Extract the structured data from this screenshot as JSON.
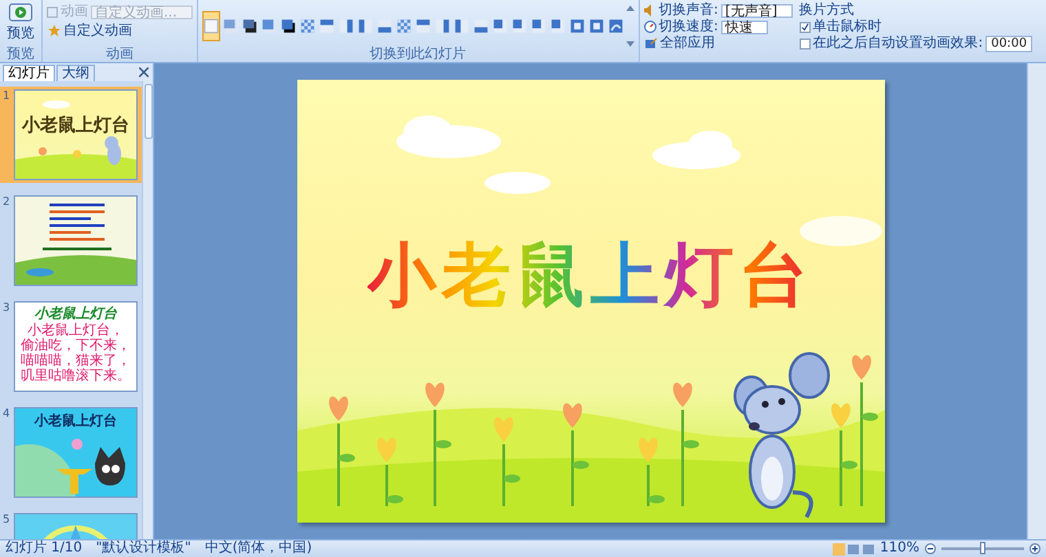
{
  "ribbon": {
    "preview": {
      "button": "预览",
      "group_label": "预览"
    },
    "animation": {
      "animate_label": "动画",
      "animate_select": "自定义动画...",
      "disabled": true,
      "custom_button": "自定义动画",
      "group_label": "动画"
    },
    "transitions": {
      "group_label": "切换到此幻灯片",
      "items": [
        {
          "kind": "plain",
          "selected": true
        },
        {
          "kind": "fade",
          "selected": false
        },
        {
          "kind": "fade-dark",
          "selected": false
        },
        {
          "kind": "cover",
          "selected": false
        },
        {
          "kind": "cover-dark",
          "selected": false
        },
        {
          "kind": "checker",
          "selected": false
        },
        {
          "kind": "bar-down",
          "selected": false
        },
        {
          "kind": "bar-left",
          "selected": false
        },
        {
          "kind": "bar-right",
          "selected": false
        },
        {
          "kind": "bar-up",
          "selected": false
        },
        {
          "kind": "checker",
          "selected": false
        },
        {
          "kind": "bar-down",
          "selected": false
        },
        {
          "kind": "bar-left",
          "selected": false
        },
        {
          "kind": "bar-right",
          "selected": false
        },
        {
          "kind": "bar-up",
          "selected": false
        },
        {
          "kind": "corner",
          "selected": false
        },
        {
          "kind": "corner",
          "selected": false
        },
        {
          "kind": "corner",
          "selected": false
        },
        {
          "kind": "corner",
          "selected": false
        },
        {
          "kind": "zoom",
          "selected": false
        },
        {
          "kind": "zoom",
          "selected": false
        },
        {
          "kind": "wheel",
          "selected": false
        }
      ]
    },
    "sound": {
      "label": "切换声音:",
      "value": "[无声音]"
    },
    "speed": {
      "label": "切换速度:",
      "value": "快速"
    },
    "apply_all": "全部应用",
    "advance": {
      "title": "换片方式",
      "on_click": {
        "label": "单击鼠标时",
        "checked": true
      },
      "after": {
        "label": "在此之后自动设置动画效果:",
        "checked": false,
        "value": "00:00"
      }
    }
  },
  "panel": {
    "tabs": [
      {
        "label": "幻灯片",
        "selected": true
      },
      {
        "label": "大纲",
        "selected": false
      }
    ],
    "slides": [
      {
        "number": "1",
        "selected": true,
        "kind": "title",
        "title": "小老鼠上灯台"
      },
      {
        "number": "2",
        "selected": false,
        "kind": "scene"
      },
      {
        "number": "3",
        "selected": false,
        "kind": "text",
        "title": "小老鼠上灯台",
        "lines": [
          "小老鼠上灯台，",
          "偷油吃，下不来，",
          "喵喵喵，猫来了，",
          "叽里咕噜滚下来。"
        ]
      },
      {
        "number": "4",
        "selected": false,
        "kind": "cartoon",
        "title": "小老鼠上灯台"
      },
      {
        "number": "5",
        "selected": false,
        "kind": "star"
      }
    ]
  },
  "slide": {
    "title": "小老鼠上灯台"
  },
  "status_bar": {
    "slide": "幻灯片 1/10",
    "theme": "\"默认设计模板\"",
    "language": "中文(简体，中国)",
    "zoom": "110%",
    "zoom_slider": {
      "level": 0.5
    }
  }
}
